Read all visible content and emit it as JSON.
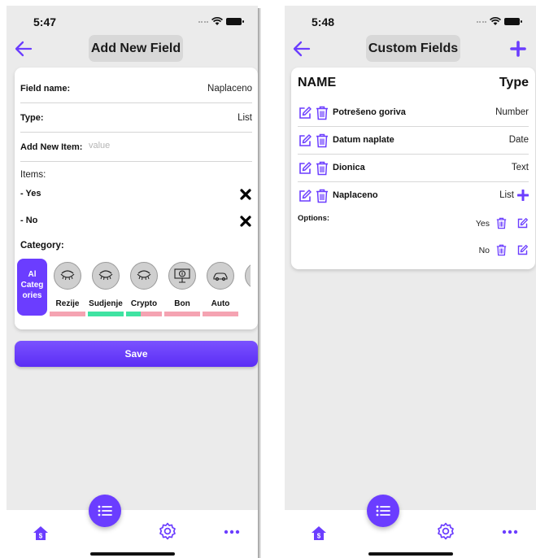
{
  "left_screen": {
    "status_time": "5:47",
    "title": "Add New Field",
    "form": {
      "field_name_label": "Field name:",
      "field_name_value": "Naplaceno",
      "type_label": "Type:",
      "type_value": "List",
      "add_item_label": "Add New Item:",
      "add_item_placeholder": "value",
      "items_label": "Items:",
      "items": [
        {
          "label": "- Yes"
        },
        {
          "label": "- No"
        }
      ],
      "category_label": "Category:"
    },
    "categories": {
      "all_line1": "Al",
      "all_line2": "Categ",
      "all_line3": "ories",
      "items": [
        {
          "name": "Rezije",
          "icon": "eye-closed-icon",
          "progress": 0
        },
        {
          "name": "Sudjenje",
          "icon": "eye-closed-icon",
          "progress": 1
        },
        {
          "name": "Crypto",
          "icon": "eye-closed-icon",
          "progress": 0.4
        },
        {
          "name": "Bon",
          "icon": "money-icon",
          "progress": 0
        },
        {
          "name": "Auto",
          "icon": "car-icon",
          "progress": 0
        }
      ]
    },
    "save_label": "Save"
  },
  "right_screen": {
    "status_time": "5:48",
    "title": "Custom Fields",
    "header_name": "NAME",
    "header_type": "Type",
    "rows": [
      {
        "name": "Potrešeno goriva",
        "type": "Number"
      },
      {
        "name": "Datum naplate",
        "type": "Date"
      },
      {
        "name": "Dionica",
        "type": "Text"
      },
      {
        "name": "Naplaceno",
        "type": "List"
      }
    ],
    "options_label": "Options:",
    "options": [
      {
        "value": "Yes"
      },
      {
        "value": "No"
      }
    ]
  },
  "colors": {
    "accent": "#6b3dff",
    "progress_on": "#3fe3a2",
    "progress_off": "#f5a3b2",
    "background": "#ebebeb"
  }
}
